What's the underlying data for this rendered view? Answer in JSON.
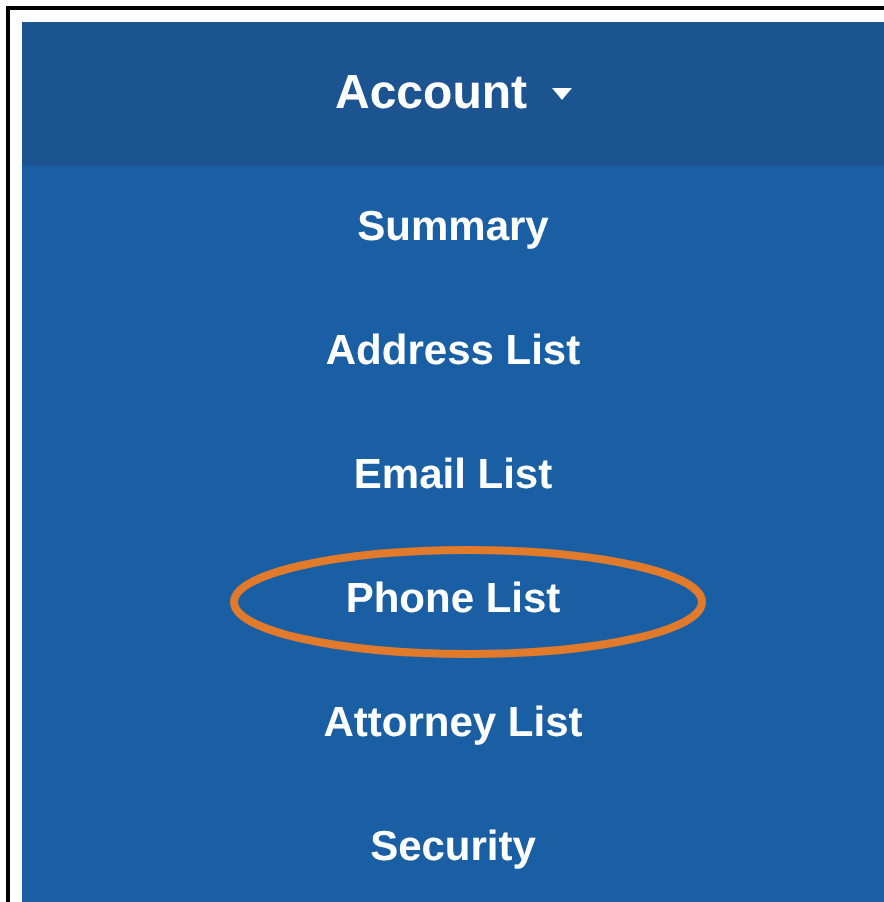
{
  "menu": {
    "title": "Account",
    "items": [
      {
        "label": "Summary",
        "circled": false
      },
      {
        "label": "Address List",
        "circled": false
      },
      {
        "label": "Email List",
        "circled": false
      },
      {
        "label": "Phone List",
        "circled": true
      },
      {
        "label": "Attorney List",
        "circled": false
      },
      {
        "label": "Security",
        "circled": false
      }
    ]
  }
}
